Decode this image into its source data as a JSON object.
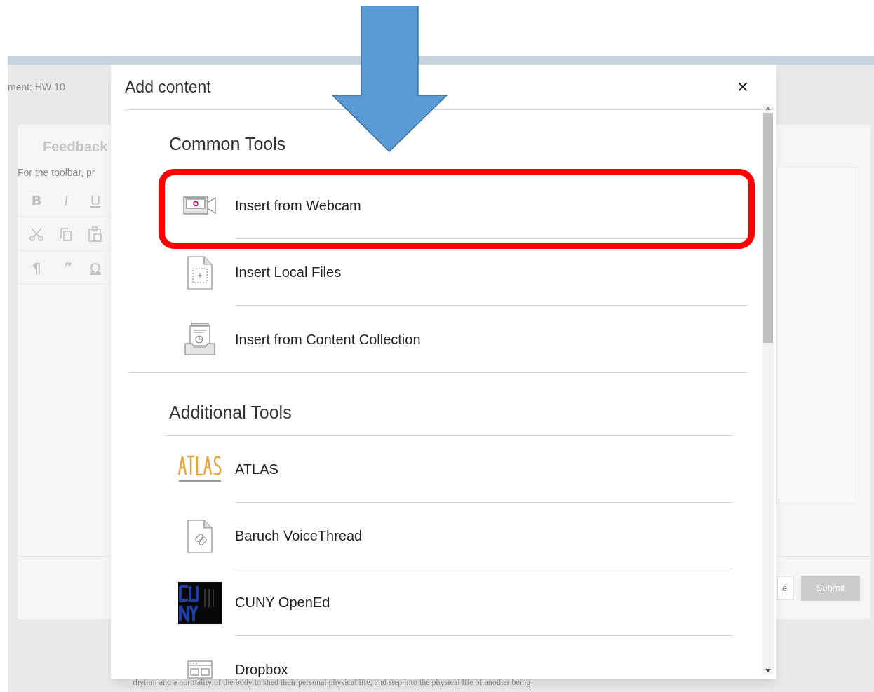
{
  "page": {
    "assignment_title": "ment: HW 10",
    "feedback": {
      "title": "Feedback",
      "hint": "For the toolbar, pr",
      "toolbar_rows": [
        {
          "kind": "glyphs",
          "glyphs": [
            "B",
            "I",
            "U"
          ]
        },
        {
          "kind": "clipboard"
        },
        {
          "kind": "glyphs",
          "glyphs": [
            "¶",
            "❞",
            "Ω"
          ]
        }
      ],
      "cancel_fragment": "el",
      "submit": "Submit"
    },
    "body_text": "rhythm and a normality of the body to shed their personal physical life, and step into the physical life of another being"
  },
  "modal": {
    "title": "Add content",
    "close": "×",
    "sections": [
      {
        "heading": "Common Tools",
        "items": [
          {
            "label": "Insert from Webcam",
            "kind": "webcam"
          },
          {
            "label": "Insert Local Files",
            "kind": "local-file"
          },
          {
            "label": "Insert from Content Collection",
            "kind": "collection"
          }
        ]
      },
      {
        "heading": "Additional Tools",
        "items": [
          {
            "label": "ATLAS",
            "kind": "atlas"
          },
          {
            "label": "Baruch VoiceThread",
            "kind": "link-file"
          },
          {
            "label": "CUNY OpenEd",
            "kind": "cuny"
          },
          {
            "label": "Dropbox",
            "kind": "dropbox"
          }
        ]
      }
    ]
  }
}
